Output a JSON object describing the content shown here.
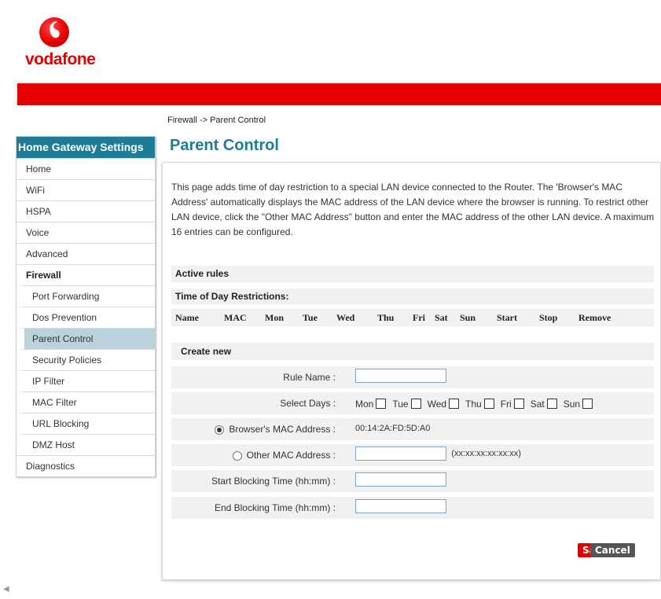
{
  "brand": {
    "name": "vodafone"
  },
  "breadcrumb": "Firewall -> Parent Control",
  "sidebar": {
    "title": "Home Gateway Settings",
    "items": [
      {
        "label": "Home",
        "level": 0,
        "bold": false,
        "active": false
      },
      {
        "label": "WiFi",
        "level": 0,
        "bold": false,
        "active": false
      },
      {
        "label": "HSPA",
        "level": 0,
        "bold": false,
        "active": false
      },
      {
        "label": "Voice",
        "level": 0,
        "bold": false,
        "active": false
      },
      {
        "label": "Advanced",
        "level": 0,
        "bold": false,
        "active": false
      },
      {
        "label": "Firewall",
        "level": 0,
        "bold": true,
        "active": false
      },
      {
        "label": "Port Forwarding",
        "level": 1,
        "bold": false,
        "active": false
      },
      {
        "label": "Dos Prevention",
        "level": 1,
        "bold": false,
        "active": false
      },
      {
        "label": "Parent Control",
        "level": 1,
        "bold": false,
        "active": true
      },
      {
        "label": "Security Policies",
        "level": 1,
        "bold": false,
        "active": false
      },
      {
        "label": "IP Filter",
        "level": 1,
        "bold": false,
        "active": false
      },
      {
        "label": "MAC Filter",
        "level": 1,
        "bold": false,
        "active": false
      },
      {
        "label": "URL Blocking",
        "level": 1,
        "bold": false,
        "active": false
      },
      {
        "label": "DMZ Host",
        "level": 1,
        "bold": false,
        "active": false
      },
      {
        "label": "Diagnostics",
        "level": 0,
        "bold": false,
        "active": false
      }
    ]
  },
  "main": {
    "title": "Parent Control",
    "intro": "This page adds time of day restriction to a special LAN device connected to the Router. The 'Browser's MAC Address' automatically displays the MAC address of the LAN device where the browser is running. To restrict other LAN device, click the \"Other MAC Address\" button and enter the MAC address of the other LAN device. A maximum 16 entries can be configured.",
    "active_rules": {
      "title": "Active rules",
      "subtitle": "Time of Day Restrictions:",
      "columns": [
        "Name",
        "MAC",
        "Mon",
        "Tue",
        "Wed",
        "Thu",
        "Fri",
        "Sat",
        "Sun",
        "Start",
        "Stop",
        "Remove"
      ]
    },
    "create_new": {
      "title": "Create new",
      "rule_name_label": "Rule Name :",
      "rule_name_value": "",
      "select_days_label": "Select Days :",
      "days": [
        {
          "label": "Mon",
          "checked": false
        },
        {
          "label": "Tue",
          "checked": false
        },
        {
          "label": "Wed",
          "checked": false
        },
        {
          "label": "Thu",
          "checked": false
        },
        {
          "label": "Fri",
          "checked": false
        },
        {
          "label": "Sat",
          "checked": false
        },
        {
          "label": "Sun",
          "checked": false
        }
      ],
      "browser_mac_label": "Browser's MAC Address :",
      "browser_mac_selected": true,
      "browser_mac_value": "00:14:2A:FD:5D:A0",
      "other_mac_label": "Other MAC Address :",
      "other_mac_selected": false,
      "other_mac_value": "",
      "other_mac_hint": "(xx:xx:xx:xx:xx:xx)",
      "start_label": "Start Blocking Time (hh:mm) :",
      "start_value": "",
      "end_label": "End Blocking Time (hh:mm) :",
      "end_value": ""
    },
    "buttons": {
      "save": "Save",
      "cancel": "Cancel"
    }
  },
  "colors": {
    "brand_red": "#e60000",
    "header_teal": "#1e7c96",
    "active_nav": "#b9d2db"
  }
}
